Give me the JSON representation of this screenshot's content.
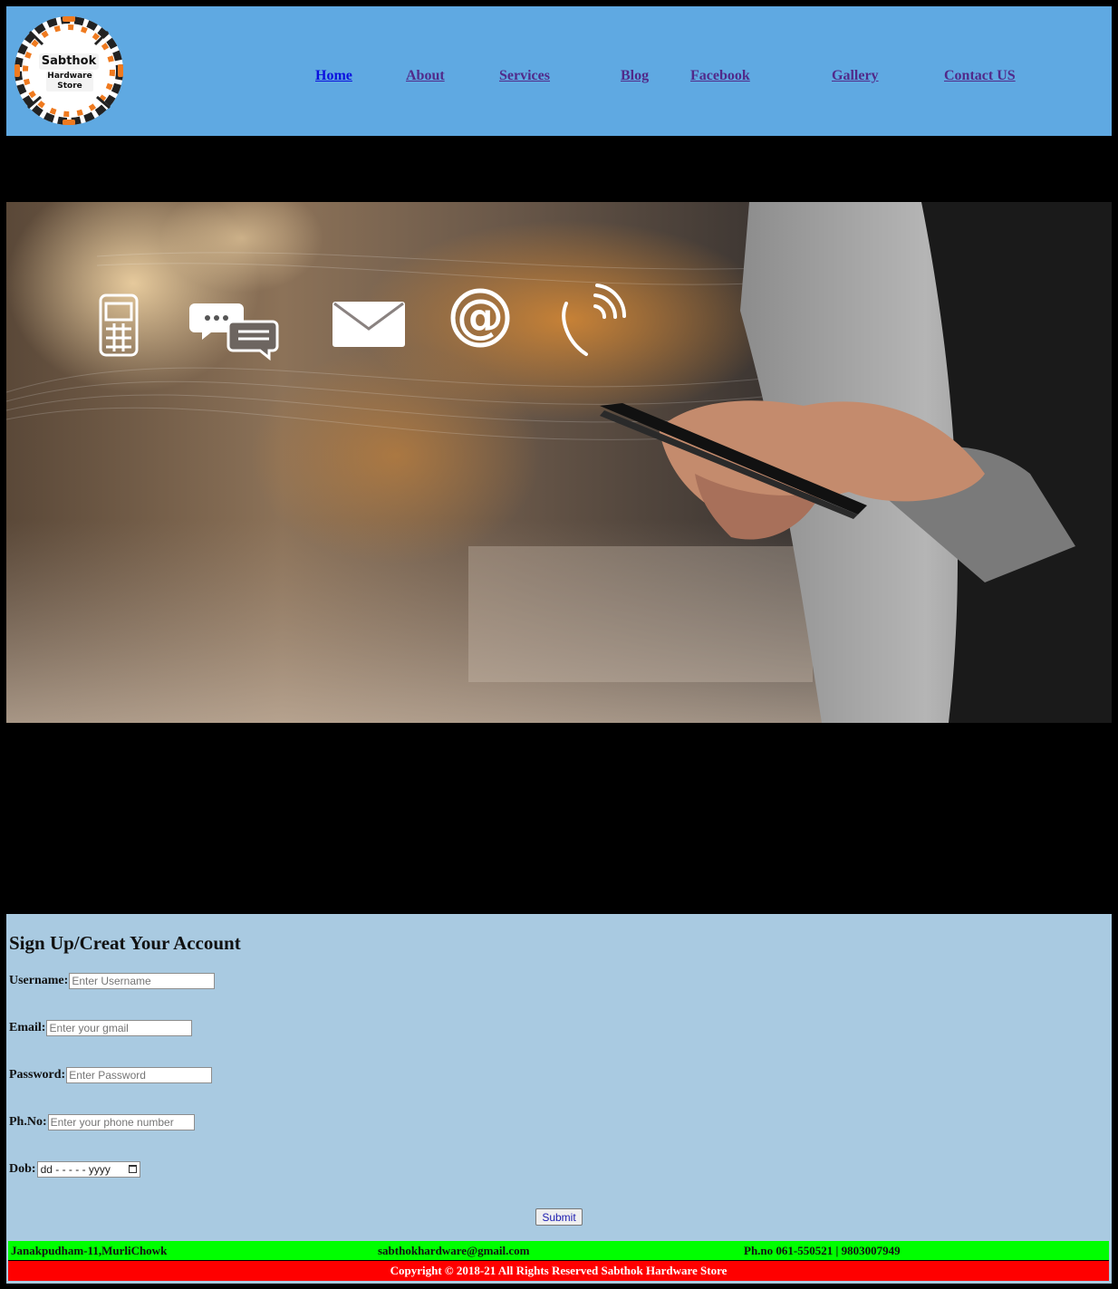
{
  "brand": {
    "logo_title": "Sabthok",
    "logo_sub_line1": "Hardware",
    "logo_sub_line2": "Store"
  },
  "nav": {
    "items": [
      {
        "label": "Home",
        "active": true
      },
      {
        "label": "About"
      },
      {
        "label": "Services"
      },
      {
        "label": "Blog"
      },
      {
        "label": "Facebook"
      },
      {
        "label": "Gallery"
      },
      {
        "label": "Contact US"
      }
    ]
  },
  "hero": {
    "icons": [
      "phone-icon",
      "chat-icon",
      "mail-icon",
      "at-icon",
      "call-icon"
    ]
  },
  "form": {
    "title": "Sign Up/Creat Your Account",
    "username_label": "Username:",
    "username_placeholder": "Enter Username",
    "email_label": "Email:",
    "email_placeholder": "Enter your gmail",
    "password_label": "Password:",
    "password_placeholder": "Enter Password",
    "phone_label": "Ph.No:",
    "phone_placeholder": "Enter your phone number",
    "dob_label": "Dob:",
    "dob_value": "dd - - - - - yyyy",
    "submit_label": "Submit"
  },
  "footer": {
    "address": "Janakpudham-11,MurliChowk",
    "email": "sabthokhardware@gmail.com",
    "phone": "Ph.no 061-550521 | 9803007949",
    "copyright": "Copyright © 2018-21 All Rights Reserved Sabthok Hardware Store"
  },
  "colors": {
    "header_bg": "#5fa9e2",
    "form_bg": "#a9cae1",
    "footer_top": "#00ff00",
    "footer_bottom": "#ff0000",
    "nav_link": "#512a8a",
    "nav_active": "#0b10de"
  }
}
